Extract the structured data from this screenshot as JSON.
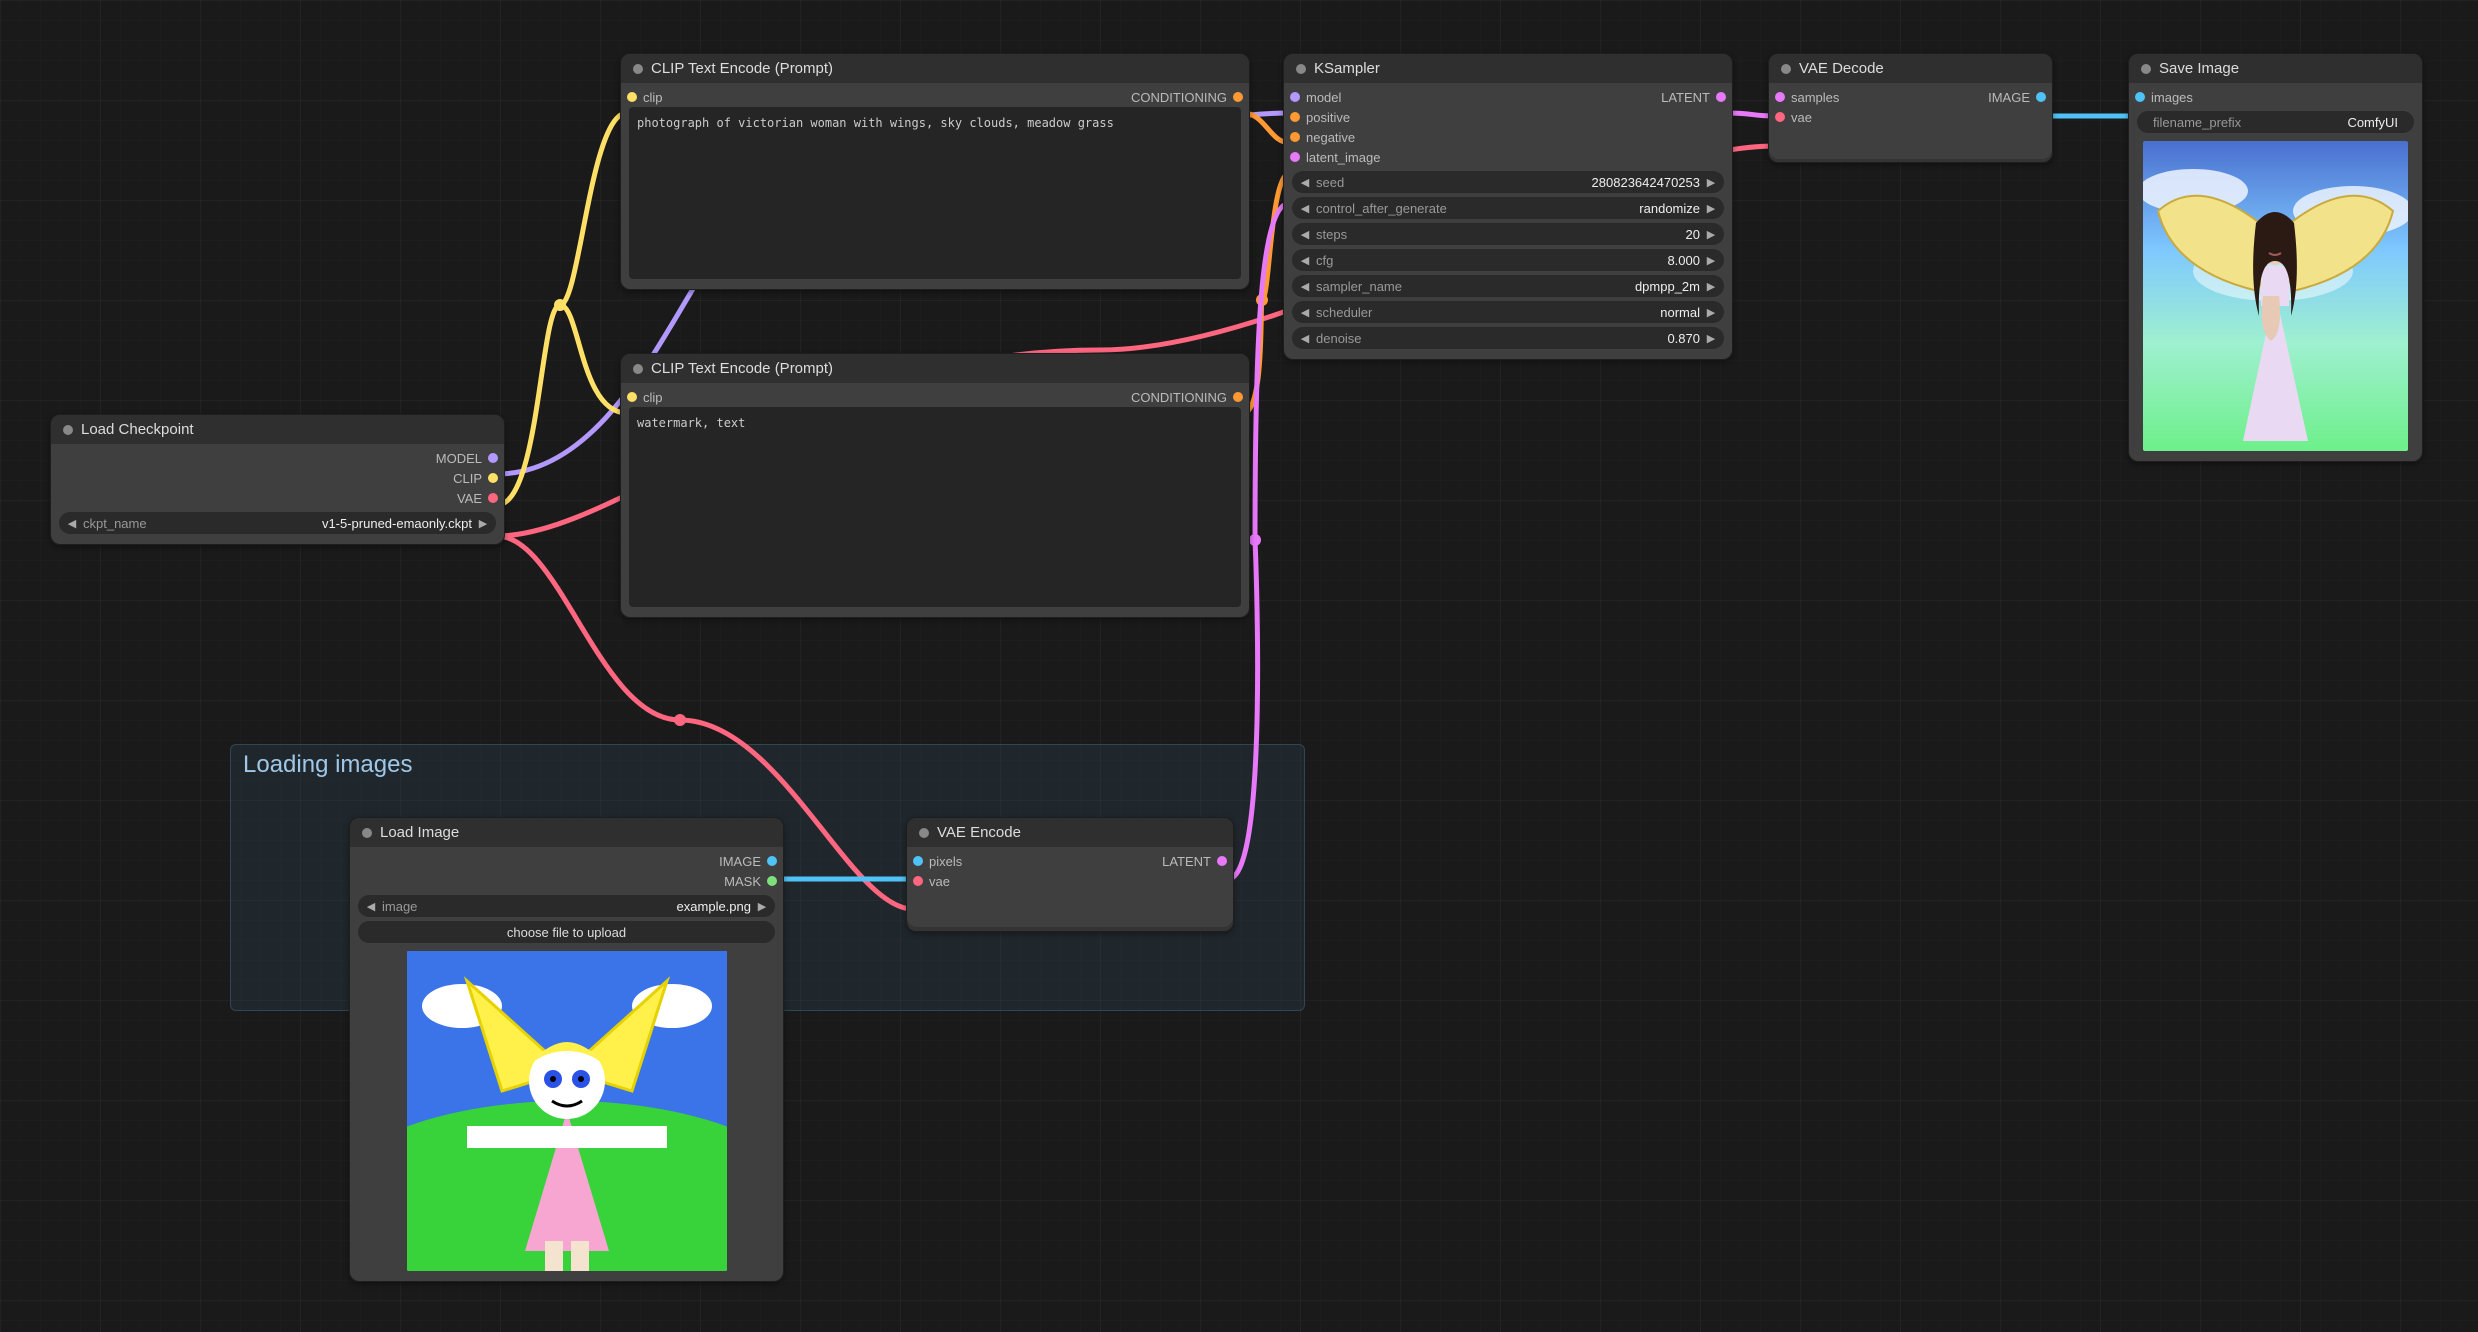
{
  "group": {
    "title": "Loading images"
  },
  "load_checkpoint": {
    "title": "Load Checkpoint",
    "out_model": "MODEL",
    "out_clip": "CLIP",
    "out_vae": "VAE",
    "ckpt_label": "ckpt_name",
    "ckpt_value": "v1-5-pruned-emaonly.ckpt"
  },
  "clip_pos": {
    "title": "CLIP Text Encode (Prompt)",
    "in_clip": "clip",
    "out_cond": "CONDITIONING",
    "text": "photograph of victorian woman with wings, sky clouds, meadow grass"
  },
  "clip_neg": {
    "title": "CLIP Text Encode (Prompt)",
    "in_clip": "clip",
    "out_cond": "CONDITIONING",
    "text": "watermark, text"
  },
  "ksampler": {
    "title": "KSampler",
    "in_model": "model",
    "in_positive": "positive",
    "in_negative": "negative",
    "in_latent": "latent_image",
    "out_latent": "LATENT",
    "widgets": {
      "seed_label": "seed",
      "seed_value": "280823642470253",
      "control_label": "control_after_generate",
      "control_value": "randomize",
      "steps_label": "steps",
      "steps_value": "20",
      "cfg_label": "cfg",
      "cfg_value": "8.000",
      "sampler_label": "sampler_name",
      "sampler_value": "dpmpp_2m",
      "scheduler_label": "scheduler",
      "scheduler_value": "normal",
      "denoise_label": "denoise",
      "denoise_value": "0.870"
    }
  },
  "vae_decode": {
    "title": "VAE Decode",
    "in_samples": "samples",
    "in_vae": "vae",
    "out_image": "IMAGE"
  },
  "save_image": {
    "title": "Save Image",
    "in_images": "images",
    "prefix_label": "filename_prefix",
    "prefix_value": "ComfyUI"
  },
  "load_image": {
    "title": "Load Image",
    "out_image": "IMAGE",
    "out_mask": "MASK",
    "image_label": "image",
    "image_value": "example.png",
    "button": "choose file to upload"
  },
  "vae_encode": {
    "title": "VAE Encode",
    "in_pixels": "pixels",
    "in_vae": "vae",
    "out_latent": "LATENT"
  }
}
